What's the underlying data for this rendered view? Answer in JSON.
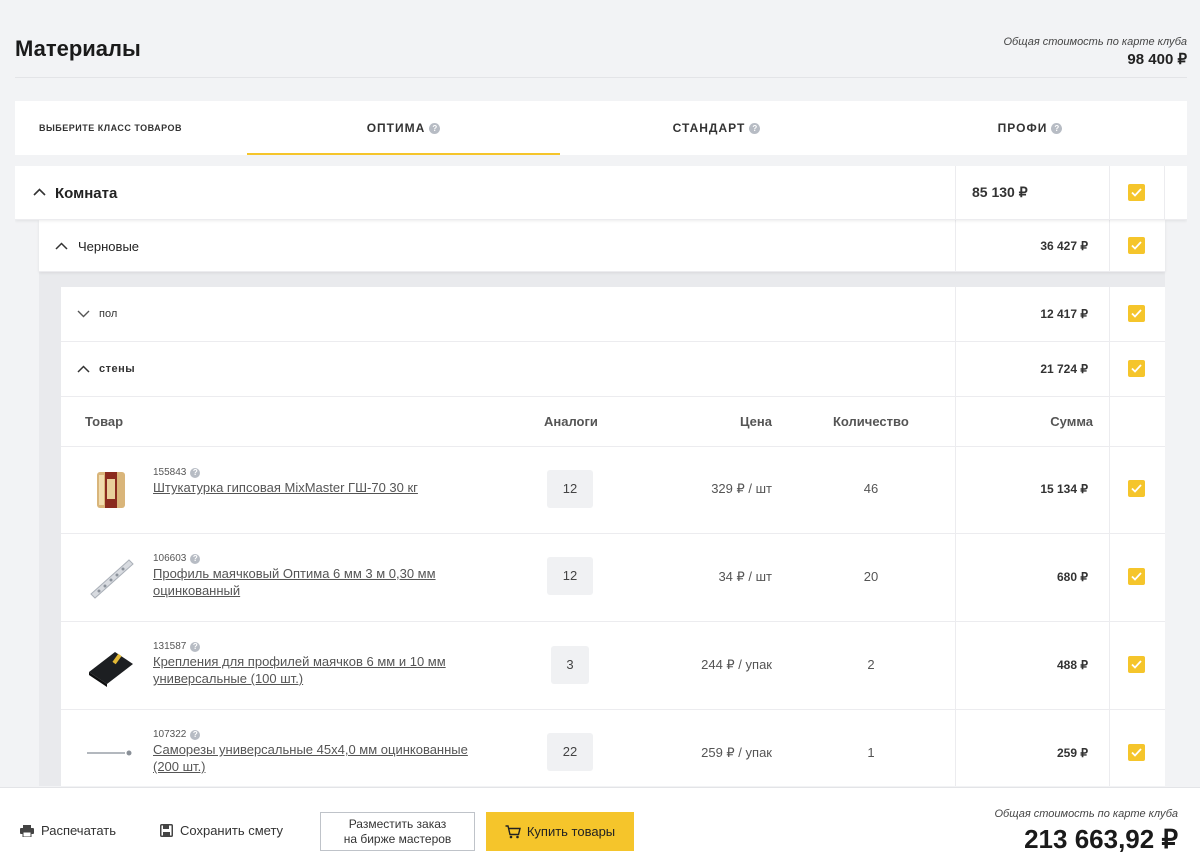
{
  "header": {
    "title": "Материалы",
    "total_label": "Общая стоимость по карте клуба",
    "total_value": "98 400 ₽"
  },
  "tabs": {
    "choose_label": "ВЫБЕРИТЕ КЛАСС ТОВАРОВ",
    "items": [
      {
        "label": "ОПТИМА",
        "active": true
      },
      {
        "label": "СТАНДАРТ",
        "active": false
      },
      {
        "label": "ПРОФИ",
        "active": false
      }
    ]
  },
  "room": {
    "title": "Комната",
    "sum": "85 130 ₽",
    "checked": true
  },
  "subgroup": {
    "title": "Черновые",
    "sum": "36 427 ₽",
    "checked": true
  },
  "categories": [
    {
      "title": "пол",
      "sum": "12 417 ₽",
      "expanded": false,
      "checked": true
    },
    {
      "title": "стены",
      "sum": "21 724 ₽",
      "expanded": true,
      "checked": true
    }
  ],
  "table": {
    "columns": {
      "product": "Товар",
      "analogs": "Аналоги",
      "price": "Цена",
      "quantity": "Количество",
      "sum": "Сумма"
    },
    "rows": [
      {
        "code": "155843",
        "name": "Штукатурка гипсовая MixMaster ГШ-70 30 кг",
        "analogs": "12",
        "price": "329 ₽  /  шт",
        "quantity": "46",
        "sum": "15 134 ₽",
        "checked": true
      },
      {
        "code": "106603",
        "name": "Профиль маячковый Оптима 6 мм 3 м 0,30 мм оцинкованный",
        "analogs": "12",
        "price": "34 ₽  /  шт",
        "quantity": "20",
        "sum": "680 ₽",
        "checked": true
      },
      {
        "code": "131587",
        "name": "Крепления для профилей маячков 6 мм и 10 мм универсальные (100 шт.)",
        "analogs": "3",
        "price": "244 ₽  /  упак",
        "quantity": "2",
        "sum": "488 ₽",
        "checked": true
      },
      {
        "code": "107322",
        "name": "Саморезы универсальные 45х4,0 мм оцинкованные (200 шт.)",
        "analogs": "22",
        "price": "259 ₽  /  упак",
        "quantity": "1",
        "sum": "259 ₽",
        "checked": true
      }
    ]
  },
  "footer": {
    "print_label": "Распечатать",
    "save_label": "Сохранить смету",
    "exchange_label_1": "Разместить заказ",
    "exchange_label_2": "на бирже мастеров",
    "buy_label": "Купить товары",
    "total_label": "Общая стоимость по карте клуба",
    "total_value": "213 663,92 ₽"
  },
  "colors": {
    "accent": "#f5c52b",
    "background": "#f2f3f5"
  }
}
